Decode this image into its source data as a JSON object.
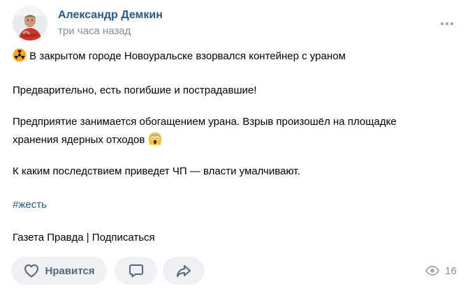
{
  "author": {
    "name": "Александр Демкин",
    "time": "три часа назад"
  },
  "post": {
    "line1": "В закрытом городе Новоуральске взорвался контейнер с ураном",
    "line2": "Предварительно, есть погибшие и пострадавшие!",
    "line3a": "Предприятие занимается обогащением урана. Взрыв произошёл на площадке",
    "line3b": "хранения ядерных отходов",
    "line4": "К каким последствием приведет ЧП — власти умалчивают.",
    "hashtag": "#жесть",
    "footer": "Газета Правда | Подписаться"
  },
  "actions": {
    "like_label": "Нравится",
    "views_count": "16"
  },
  "icons": {
    "radioactive": "radioactive-icon",
    "scream": "face-screaming-icon",
    "heart": "heart-icon",
    "comment": "comment-icon",
    "share": "share-icon",
    "eye": "eye-icon",
    "more": "more-icon"
  },
  "colors": {
    "link": "#2a5885",
    "secondary": "#818c99",
    "button_bg": "#eef0f3",
    "button_icon": "#55677d"
  }
}
